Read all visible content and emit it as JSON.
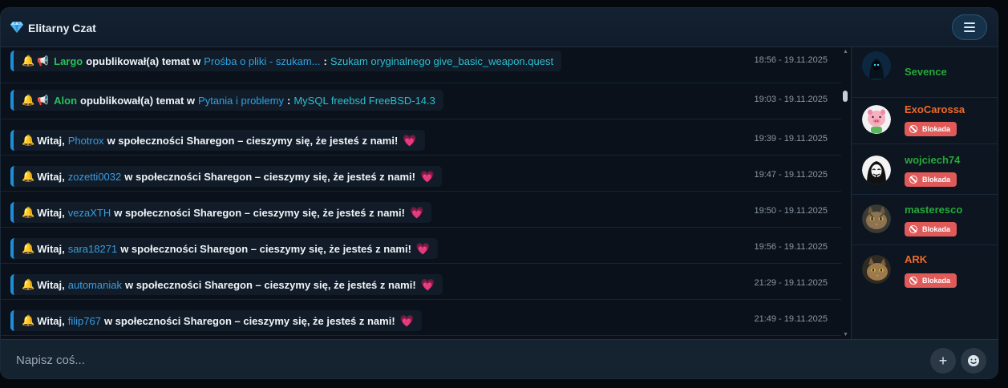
{
  "header": {
    "title": "Elitarny Czat",
    "icon": "gem-icon",
    "menu_icon": "hamburger-menu-icon"
  },
  "messages": [
    {
      "type": "topic",
      "user": "Largo",
      "action": "opublikował(a) temat w",
      "forum": "Prośba o pliki - szukam...",
      "separator": ":",
      "topic": "Szukam oryginalnego give_basic_weapon.quest",
      "time": "18:56 - 19.11.2025"
    },
    {
      "type": "topic",
      "user": "Alon",
      "action": "opublikował(a) temat w",
      "forum": "Pytania i problemy",
      "separator": ":",
      "topic": "MySQL freebsd FreeBSD-14.3",
      "time": "19:03 - 19.11.2025"
    },
    {
      "type": "welcome",
      "greeting": "Witaj,",
      "user": "Photrox",
      "text": "w społeczności Sharegon – cieszymy się, że jesteś z nami!",
      "time": "19:39 - 19.11.2025"
    },
    {
      "type": "welcome",
      "greeting": "Witaj,",
      "user": "zozetti0032",
      "text": "w społeczności Sharegon – cieszymy się, że jesteś z nami!",
      "time": "19:47 - 19.11.2025"
    },
    {
      "type": "welcome",
      "greeting": "Witaj,",
      "user": "vezaXTH",
      "text": "w społeczności Sharegon – cieszymy się, że jesteś z nami!",
      "time": "19:50 - 19.11.2025"
    },
    {
      "type": "welcome",
      "greeting": "Witaj,",
      "user": "sara18271",
      "text": "w społeczności Sharegon – cieszymy się, że jesteś z nami!",
      "time": "19:56 - 19.11.2025"
    },
    {
      "type": "welcome",
      "greeting": "Witaj,",
      "user": "automaniak",
      "text": "w społeczności Sharegon – cieszymy się, że jesteś z nami!",
      "time": "21:29 - 19.11.2025"
    },
    {
      "type": "welcome",
      "greeting": "Witaj,",
      "user": "filip767",
      "text": "w społeczności Sharegon – cieszymy się, że jesteś z nami!",
      "time": "21:49 - 19.11.2025"
    }
  ],
  "users": [
    {
      "name": "Sevence",
      "color": "#27a83a",
      "badge": ""
    },
    {
      "name": "ExoCarossa",
      "color": "#f06a2a",
      "badge": "Blokada"
    },
    {
      "name": "wojciech74",
      "color": "#27a83a",
      "badge": "Blokada"
    },
    {
      "name": "masteresco",
      "color": "#27a83a",
      "badge": "Blokada"
    },
    {
      "name": "ARK",
      "color": "#f06a2a",
      "badge": "Blokada"
    }
  ],
  "composer": {
    "placeholder": "Napisz coś...",
    "add_label": "+",
    "add_icon": "plus-icon",
    "emoji_icon": "smiley-icon"
  }
}
